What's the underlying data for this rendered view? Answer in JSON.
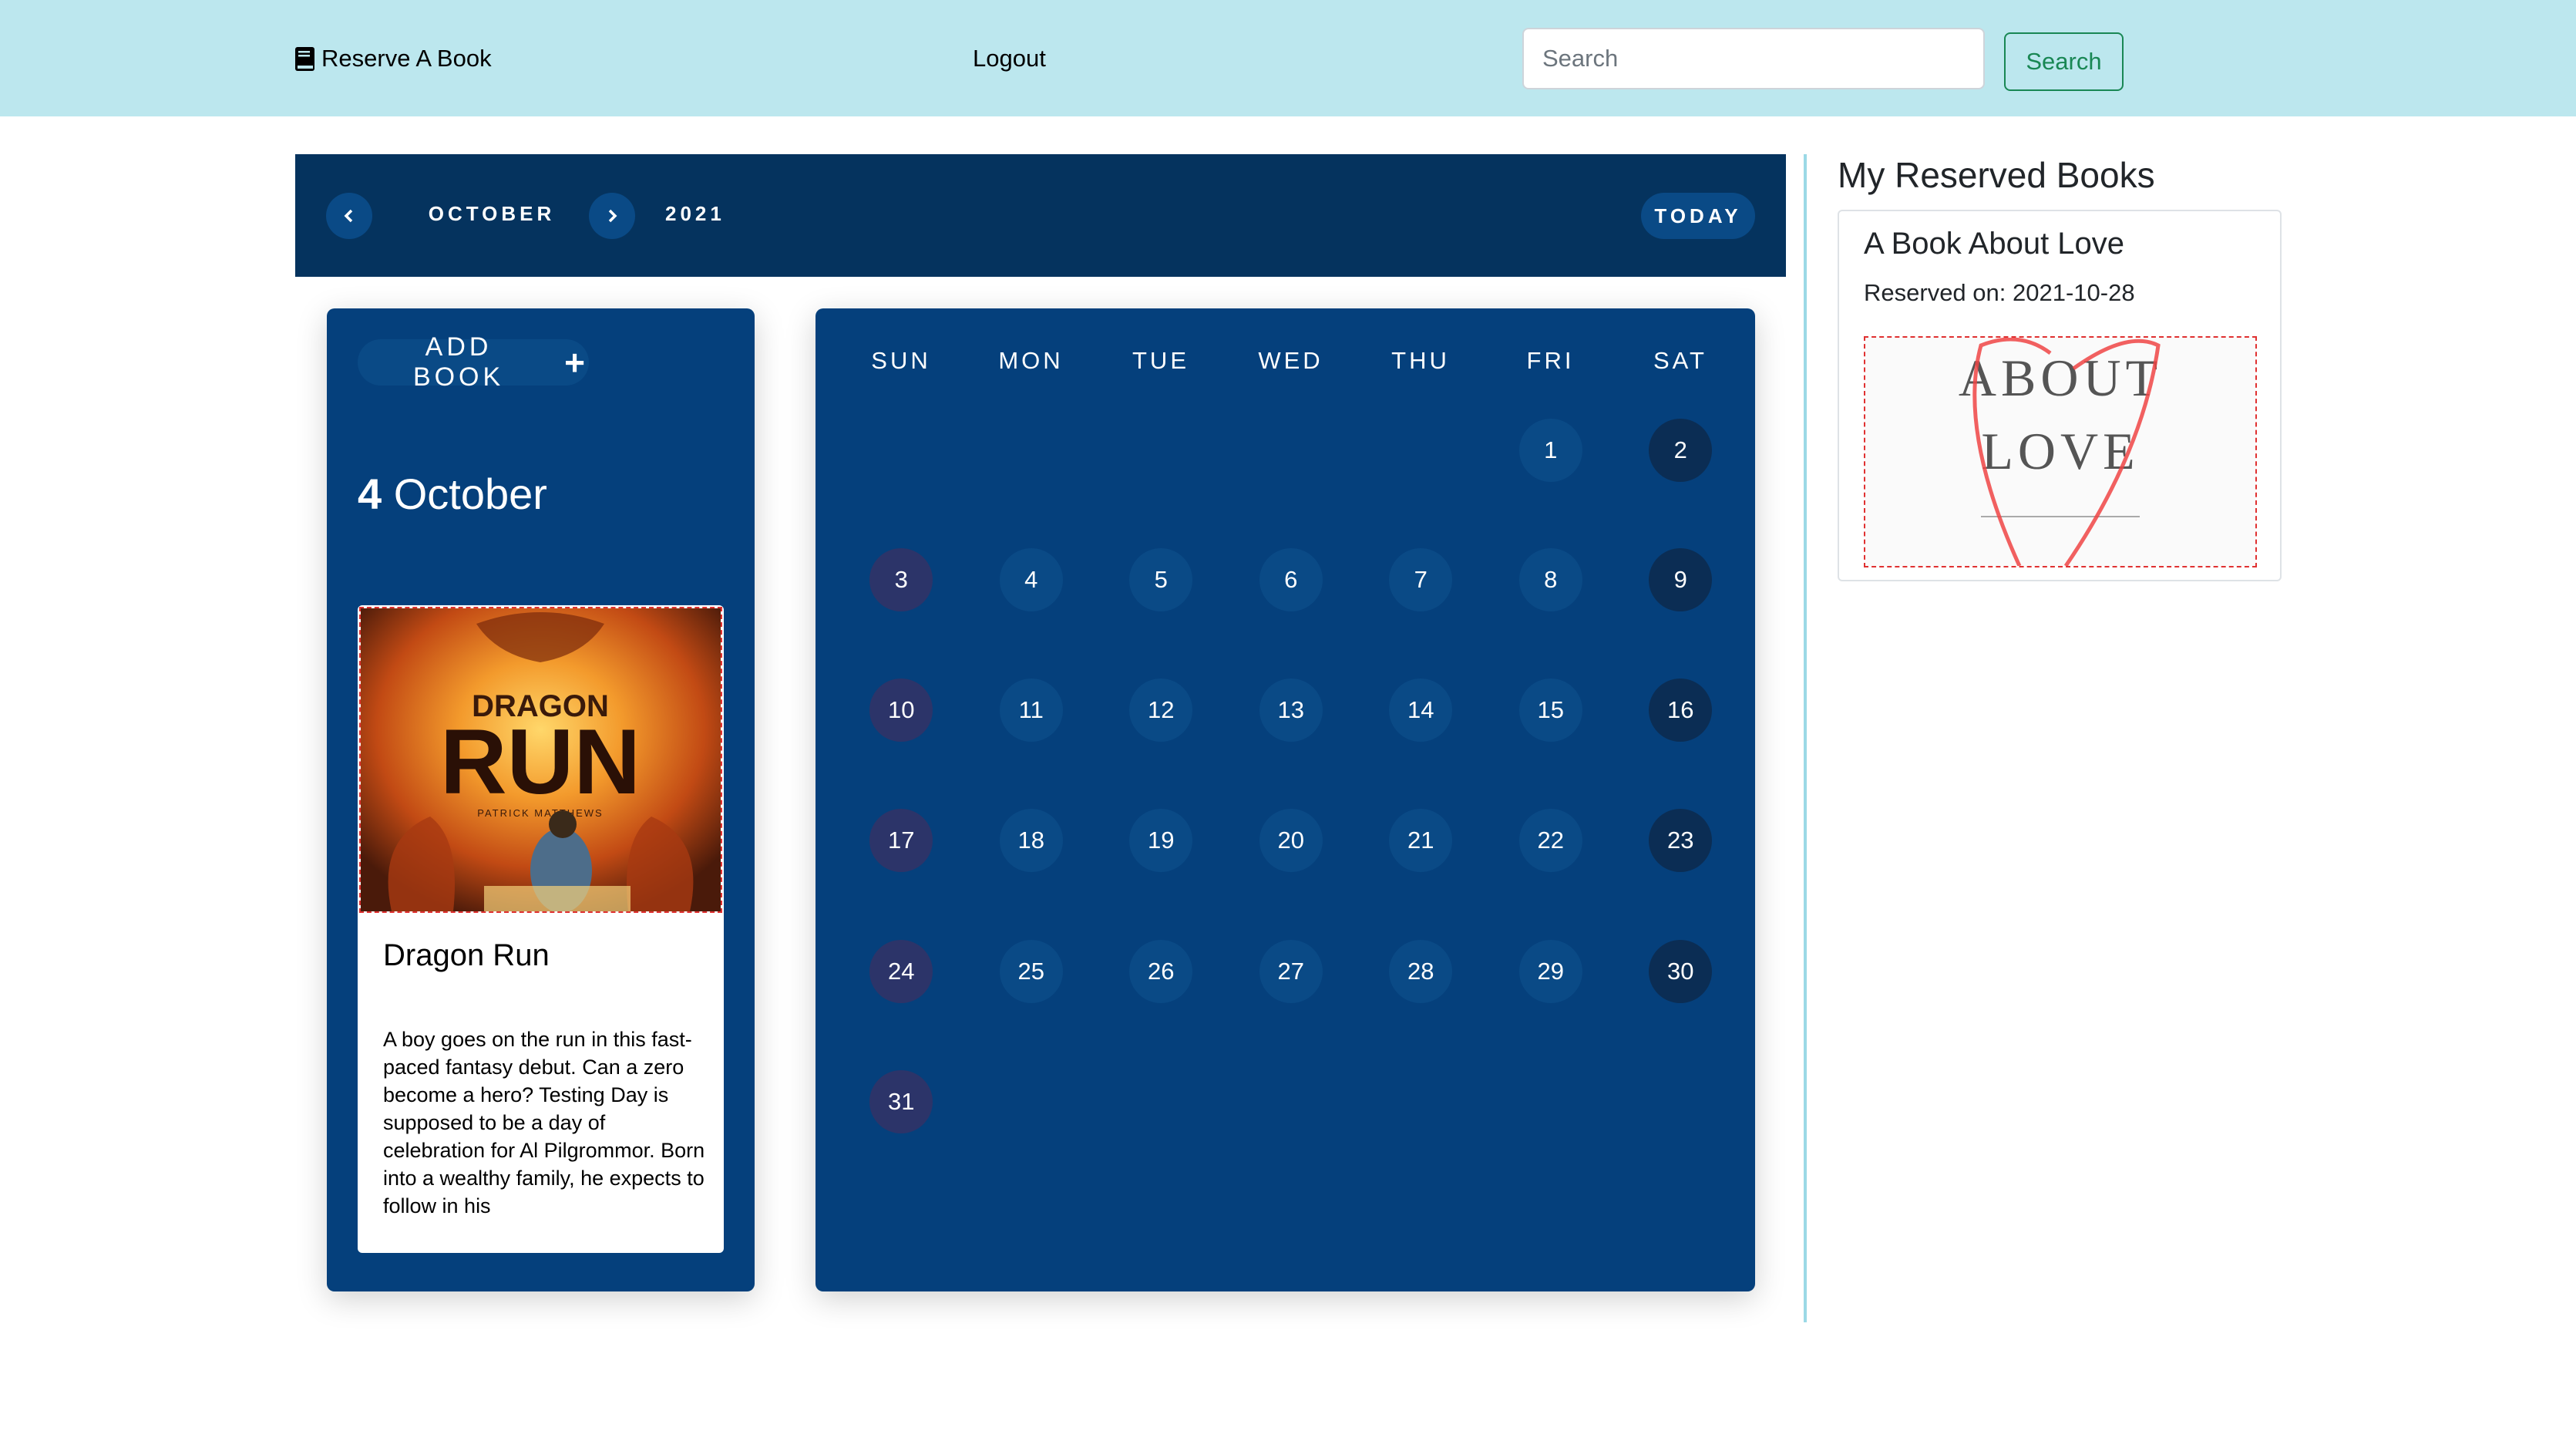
{
  "navbar": {
    "brand": "Reserve A Book",
    "logout": "Logout",
    "search_placeholder": "Search",
    "search_button": "Search"
  },
  "calendar_header": {
    "month": "OCTOBER",
    "year": "2021",
    "today_button": "TODAY"
  },
  "day_panel": {
    "add_book_label": "ADD BOOK",
    "selected_day": "4",
    "selected_month": "October",
    "book": {
      "title": "Dragon Run",
      "description": "A boy goes on the run in this fast-paced fantasy debut. Can a zero become a hero? Testing Day is supposed to be a day of celebration for Al Pilgrommor. Born into a wealthy family, he expects to follow in his",
      "cover_title_line1": "DRAGON",
      "cover_title_line2": "RUN",
      "cover_author": "PATRICK MATTHEWS"
    }
  },
  "calendar": {
    "weekdays": [
      "SUN",
      "MON",
      "TUE",
      "WED",
      "THU",
      "FRI",
      "SAT"
    ],
    "first_weekday_index": 5,
    "days_in_month": 31
  },
  "reserved": {
    "heading": "My Reserved Books",
    "items": [
      {
        "title": "A Book About Love",
        "reserved_on": "Reserved on: 2021-10-28",
        "cover_line1": "ABOUT",
        "cover_line2": "LOVE"
      }
    ]
  },
  "colors": {
    "navbar_bg": "#bce7ee",
    "calendar_header_bg": "#05335e",
    "panel_bg": "#05407c",
    "search_button": "#198754",
    "divider": "#9bd9e6"
  }
}
